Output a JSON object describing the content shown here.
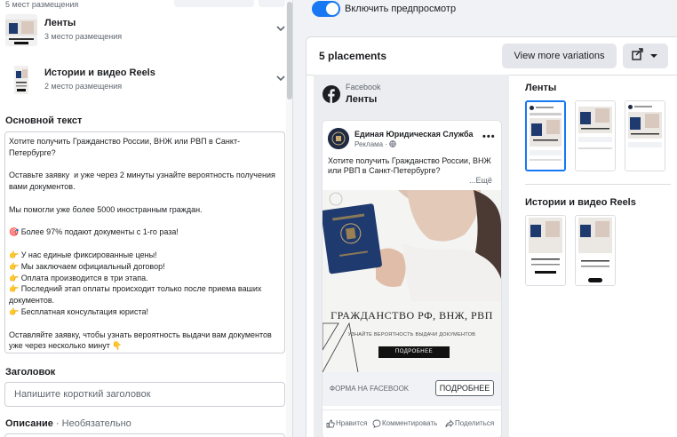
{
  "left": {
    "top_count": "5 мест размещения",
    "placements": [
      {
        "name": "Ленты",
        "sub": "3 место размещения"
      },
      {
        "name": "Истории и видео Reels",
        "sub": "2 место размещения"
      }
    ],
    "primary_text_label": "Основной текст",
    "primary_text": [
      "Хотите получить Гражданство России, ВНЖ или РВП в Санкт-Петербурге?",
      "",
      "Оставьте заявку  и уже через 2 минуты узнайте вероятность получения вами документов.",
      "",
      "Мы помогли уже более 5000 иностранным граждан.",
      "",
      "🎯 Более 97% подают документы с 1-го раза!",
      "",
      "👉 У нас единые фиксированные цены!",
      "👉 Мы заключаем официальный договор!",
      "👉 Оплата производится в три этапа.",
      "👉 Последний этап оплаты происходит только после приема ваших документов.",
      "👉 Бесплатная консультация юриста!",
      "",
      "Оставляйте заявку, чтобы узнать вероятность выдачи вам документов уже через несколько минут 👇"
    ],
    "headline_label": "Заголовок",
    "headline_placeholder": "Напишите короткий заголовок",
    "description_label": "Описание",
    "description_optional": " · Необязательно"
  },
  "preview_toggle": {
    "label": "Включить предпросмотр",
    "on": true
  },
  "card": {
    "title": "5 placements",
    "more_button": "View more variations"
  },
  "preview": {
    "platform": "Facebook",
    "feed": "Ленты",
    "post": {
      "page_name": "Единая Юридическая Служба",
      "sponsored": "Реклама · ",
      "text": "Хотите получить Гражданство России, ВНЖ или РВП в Санкт-Петербурге?",
      "more": "...Ещё",
      "image": {
        "headline": "ГРАЖДАНСТВО РФ, ВНЖ, РВП",
        "subline": "УЗНАЙТЕ ВЕРОЯТНОСТЬ ВЫДАЧИ ДОКУМЕНТОВ",
        "button": "ПОДРОБНЕЕ"
      },
      "cta_caption": "ФОРМА НА FACEBOOK",
      "cta_button": "ПОДРОБНЕЕ",
      "actions": [
        "Нравится",
        "Комментировать",
        "Поделиться"
      ]
    }
  },
  "variations": {
    "feeds_title": "Ленты",
    "stories_title": "Истории и видео Reels"
  },
  "colors": {
    "accent": "#1877f2",
    "passport": "#1f3a6e"
  }
}
